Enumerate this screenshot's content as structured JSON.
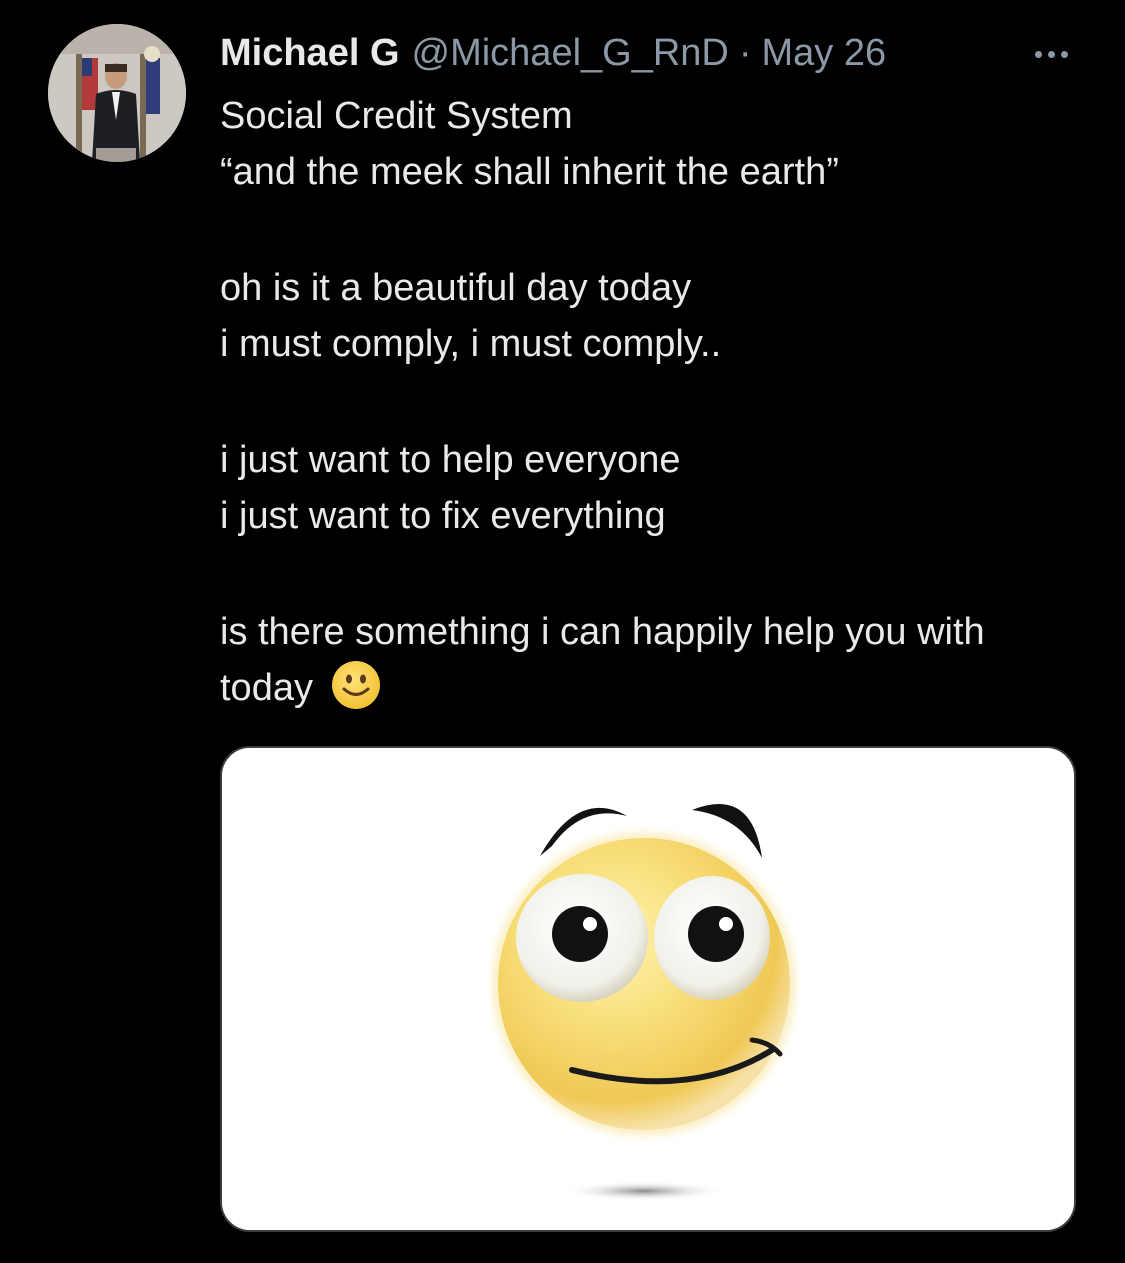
{
  "tweet": {
    "author": {
      "display_name": "Michael G",
      "handle": "@Michael_G_RnD"
    },
    "separator": "·",
    "timestamp": "May 26",
    "text_lines": [
      "Social Credit System",
      "“and the meek shall inherit the earth”",
      "",
      "oh is it a beautiful day today",
      "i must comply, i must comply..",
      "",
      "i just want to help everyone",
      "i just want to fix everything",
      "",
      "is there something i can happily help you with",
      "today"
    ],
    "inline_emoji": "slightly-smiling-face",
    "media": {
      "type": "image",
      "subject": "smiling-emoji-illustration"
    }
  },
  "icons": {
    "more": "ellipsis-icon"
  },
  "colors": {
    "background": "#000000",
    "primary_text": "#e7e9ea",
    "secondary_text": "#8b98a5",
    "media_border": "#3a3f44",
    "emoji_yellow": "#f5cf4c"
  }
}
